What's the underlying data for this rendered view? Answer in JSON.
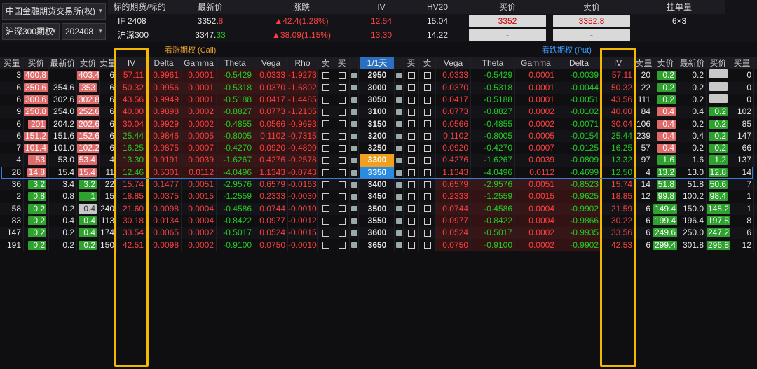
{
  "exchange": "中国金融期货交易所(权)",
  "product": "沪深300期权",
  "month": "202408",
  "quote": {
    "headers": [
      "标的期货/标的",
      "最新价",
      "涨跌",
      "IV",
      "HV20",
      "买价",
      "卖价",
      "挂单量"
    ],
    "rows": [
      {
        "name": "IF 2408",
        "last_main": "3352.",
        "last_tail": "8",
        "chg": "▲42.4(1.28%)",
        "iv": "12.54",
        "hv": "15.04",
        "bid": "3352",
        "ask": "3352.8",
        "order": "6×3"
      },
      {
        "name": "沪深300",
        "last_main": "3347.",
        "last_tail": "33",
        "chg": "▲38.09(1.15%)",
        "iv": "13.30",
        "hv": "14.22",
        "bid": "-",
        "ask": "-",
        "order": ""
      }
    ]
  },
  "call_title": "看涨期权 (Call)",
  "put_title": "看跌期权 (Put)",
  "days": "1/1天",
  "headers": {
    "call": [
      "买量",
      "买价",
      "最新价",
      "卖价",
      "卖量",
      "IV",
      "Delta",
      "Gamma",
      "Theta",
      "Vega",
      "Rho",
      "卖",
      "买"
    ],
    "strike": "",
    "put": [
      "买",
      "卖",
      "Vega",
      "Theta",
      "Gamma",
      "Delta",
      "IV",
      "卖量",
      "卖价",
      "最新价",
      "买价",
      "买量"
    ]
  },
  "rows": [
    {
      "k": "2950",
      "cbq": "3",
      "cbp": "400.8",
      "cl": "",
      "cap": "403.4",
      "caq": "6",
      "civ": "57.11",
      "cd": "0.9961",
      "cg": "0.0001",
      "ct": "-0.5429",
      "cv": "0.0333",
      "cr": "-1.9273",
      "pv": "0.0333",
      "pt": "-0.5429",
      "pg": "0.0001",
      "pd": "-0.0039",
      "piv": "57.11",
      "paq": "20",
      "pap": "0.2",
      "pl": "0.2",
      "pbp": "",
      "pbq": "0"
    },
    {
      "k": "3000",
      "cbq": "6",
      "cbp": "350.6",
      "cl": "354.6",
      "cap": "353",
      "caq": "6",
      "civ": "50.32",
      "cd": "0.9956",
      "cg": "0.0001",
      "ct": "-0.5318",
      "cv": "0.0370",
      "cr": "-1.6802",
      "pv": "0.0370",
      "pt": "-0.5318",
      "pg": "0.0001",
      "pd": "-0.0044",
      "piv": "50.32",
      "paq": "22",
      "pap": "0.2",
      "pl": "0.2",
      "pbp": "",
      "pbq": "0"
    },
    {
      "k": "3050",
      "cbq": "6",
      "cbp": "300.6",
      "cl": "302.6",
      "cap": "302.8",
      "caq": "6",
      "civ": "43.56",
      "cd": "0.9949",
      "cg": "0.0001",
      "ct": "-0.5188",
      "cv": "0.0417",
      "cr": "-1.4485",
      "pv": "0.0417",
      "pt": "-0.5188",
      "pg": "0.0001",
      "pd": "-0.0051",
      "piv": "43.56",
      "paq": "111",
      "pap": "0.2",
      "pl": "0.2",
      "pbp": "",
      "pbq": "0"
    },
    {
      "k": "3100",
      "cbq": "9",
      "cbp": "250.8",
      "cl": "254.0",
      "cap": "252.6",
      "caq": "6",
      "civ": "40.00",
      "cd": "0.9898",
      "cg": "0.0002",
      "ct": "-0.8827",
      "cv": "0.0773",
      "cr": "-1.2105",
      "pv": "0.0773",
      "pt": "-0.8827",
      "pg": "0.0002",
      "pd": "-0.0102",
      "piv": "40.00",
      "paq": "84",
      "pap": "0.4",
      "pl": "0.4",
      "pbp": "0.2",
      "pbq": "102"
    },
    {
      "k": "3150",
      "cbq": "6",
      "cbp": "201",
      "cl": "204.2",
      "cap": "202.6",
      "caq": "6",
      "civ": "30.04",
      "cd": "0.9929",
      "cg": "0.0002",
      "ct": "-0.4855",
      "cv": "0.0566",
      "cr": "-0.9693",
      "pv": "0.0566",
      "pt": "-0.4855",
      "pg": "0.0002",
      "pd": "-0.0071",
      "piv": "30.04",
      "paq": "106",
      "pap": "0.4",
      "pl": "0.2",
      "pbp": "0.2",
      "pbq": "85"
    },
    {
      "k": "3200",
      "cbq": "6",
      "cbp": "151.2",
      "cl": "151.6",
      "cap": "152.6",
      "caq": "6",
      "civ": "25.44",
      "cd": "0.9846",
      "cg": "0.0005",
      "ct": "-0.8005",
      "cv": "0.1102",
      "cr": "-0.7315",
      "pv": "0.1102",
      "pt": "-0.8005",
      "pg": "0.0005",
      "pd": "-0.0154",
      "piv": "25.44",
      "paq": "239",
      "pap": "0.4",
      "pl": "0.4",
      "pbp": "0.2",
      "pbq": "147"
    },
    {
      "k": "3250",
      "cbq": "7",
      "cbp": "101.4",
      "cl": "101.0",
      "cap": "102.2",
      "caq": "6",
      "civ": "16.25",
      "cd": "0.9875",
      "cg": "0.0007",
      "ct": "-0.4270",
      "cv": "0.0920",
      "cr": "-0.4890",
      "pv": "0.0920",
      "pt": "-0.4270",
      "pg": "0.0007",
      "pd": "-0.0125",
      "piv": "16.25",
      "paq": "57",
      "pap": "0.4",
      "pl": "0.2",
      "pbp": "0.2",
      "pbq": "66"
    },
    {
      "k": "3300",
      "cbq": "4",
      "cbp": "53",
      "cl": "53.0",
      "cap": "53.4",
      "caq": "4",
      "civ": "13.30",
      "cd": "0.9191",
      "cg": "0.0039",
      "ct": "-1.6267",
      "cv": "0.4276",
      "cr": "-0.2578",
      "pv": "0.4276",
      "pt": "-1.6267",
      "pg": "0.0039",
      "pd": "-0.0809",
      "piv": "13.32",
      "paq": "97",
      "pap": "1.6",
      "pl": "1.6",
      "pbp": "1.2",
      "pbq": "137"
    },
    {
      "k": "3350",
      "cbq": "28",
      "cbp": "14.8",
      "cl": "15.4",
      "cap": "15.4",
      "caq": "11",
      "civ": "12.46",
      "cd": "0.5301",
      "cg": "0.0112",
      "ct": "-4.0496",
      "cv": "1.1343",
      "cr": "-0.0743",
      "pv": "1.1343",
      "pt": "-4.0496",
      "pg": "0.0112",
      "pd": "-0.4699",
      "piv": "12.50",
      "paq": "4",
      "pap": "13.2",
      "pl": "13.0",
      "pbp": "12.8",
      "pbq": "14"
    },
    {
      "k": "3400",
      "cbq": "36",
      "cbp": "3.2",
      "cl": "3.4",
      "cap": "3.2",
      "caq": "22",
      "civ": "15.74",
      "cd": "0.1477",
      "cg": "0.0051",
      "ct": "-2.9576",
      "cv": "0.6579",
      "cr": "-0.0163",
      "pv": "0.6579",
      "pt": "-2.9576",
      "pg": "0.0051",
      "pd": "-0.8523",
      "piv": "15.74",
      "paq": "14",
      "pap": "51.8",
      "pl": "51.8",
      "pbp": "50.6",
      "pbq": "7"
    },
    {
      "k": "3450",
      "cbq": "2",
      "cbp": "0.8",
      "cl": "0.8",
      "cap": "1",
      "caq": "15",
      "civ": "18.85",
      "cd": "0.0375",
      "cg": "0.0015",
      "ct": "-1.2559",
      "cv": "0.2333",
      "cr": "-0.0030",
      "pv": "0.2333",
      "pt": "-1.2559",
      "pg": "0.0015",
      "pd": "-0.9625",
      "piv": "18.85",
      "paq": "12",
      "pap": "99.8",
      "pl": "100.2",
      "pbp": "98.4",
      "pbq": "1"
    },
    {
      "k": "3500",
      "cbq": "58",
      "cbp": "0.2",
      "cl": "0.2",
      "cap": "0.4",
      "caq": "240",
      "civ": "21.60",
      "cd": "0.0098",
      "cg": "0.0004",
      "ct": "-0.4586",
      "cv": "0.0744",
      "cr": "-0.0010",
      "pv": "0.0744",
      "pt": "-0.4586",
      "pg": "0.0004",
      "pd": "-0.9902",
      "piv": "21.59",
      "paq": "6",
      "pap": "149.4",
      "pl": "150.0",
      "pbp": "148.2",
      "pbq": "1"
    },
    {
      "k": "3550",
      "cbq": "83",
      "cbp": "0.2",
      "cl": "0.4",
      "cap": "0.4",
      "caq": "113",
      "civ": "30.18",
      "cd": "0.0134",
      "cg": "0.0004",
      "ct": "-0.8422",
      "cv": "0.0977",
      "cr": "-0.0012",
      "pv": "0.0977",
      "pt": "-0.8422",
      "pg": "0.0004",
      "pd": "-0.9866",
      "piv": "30.22",
      "paq": "6",
      "pap": "199.4",
      "pl": "196.4",
      "pbp": "197.8",
      "pbq": "8"
    },
    {
      "k": "3600",
      "cbq": "147",
      "cbp": "0.2",
      "cl": "0.2",
      "cap": "0.4",
      "caq": "174",
      "civ": "33.54",
      "cd": "0.0065",
      "cg": "0.0002",
      "ct": "-0.5017",
      "cv": "0.0524",
      "cr": "-0.0015",
      "pv": "0.0524",
      "pt": "-0.5017",
      "pg": "0.0002",
      "pd": "-0.9935",
      "piv": "33.56",
      "paq": "6",
      "pap": "249.6",
      "pl": "250.0",
      "pbp": "247.2",
      "pbq": "6"
    },
    {
      "k": "3650",
      "cbq": "191",
      "cbp": "0.2",
      "cl": "0.2",
      "cap": "0.2",
      "caq": "150",
      "civ": "42.51",
      "cd": "0.0098",
      "cg": "0.0002",
      "ct": "-0.9100",
      "cv": "0.0750",
      "cr": "-0.0010",
      "pv": "0.0750",
      "pt": "-0.9100",
      "pg": "0.0002",
      "pd": "-0.9902",
      "piv": "42.53",
      "paq": "6",
      "pap": "299.4",
      "pl": "301.8",
      "pbp": "296.8",
      "pbq": "12"
    }
  ]
}
